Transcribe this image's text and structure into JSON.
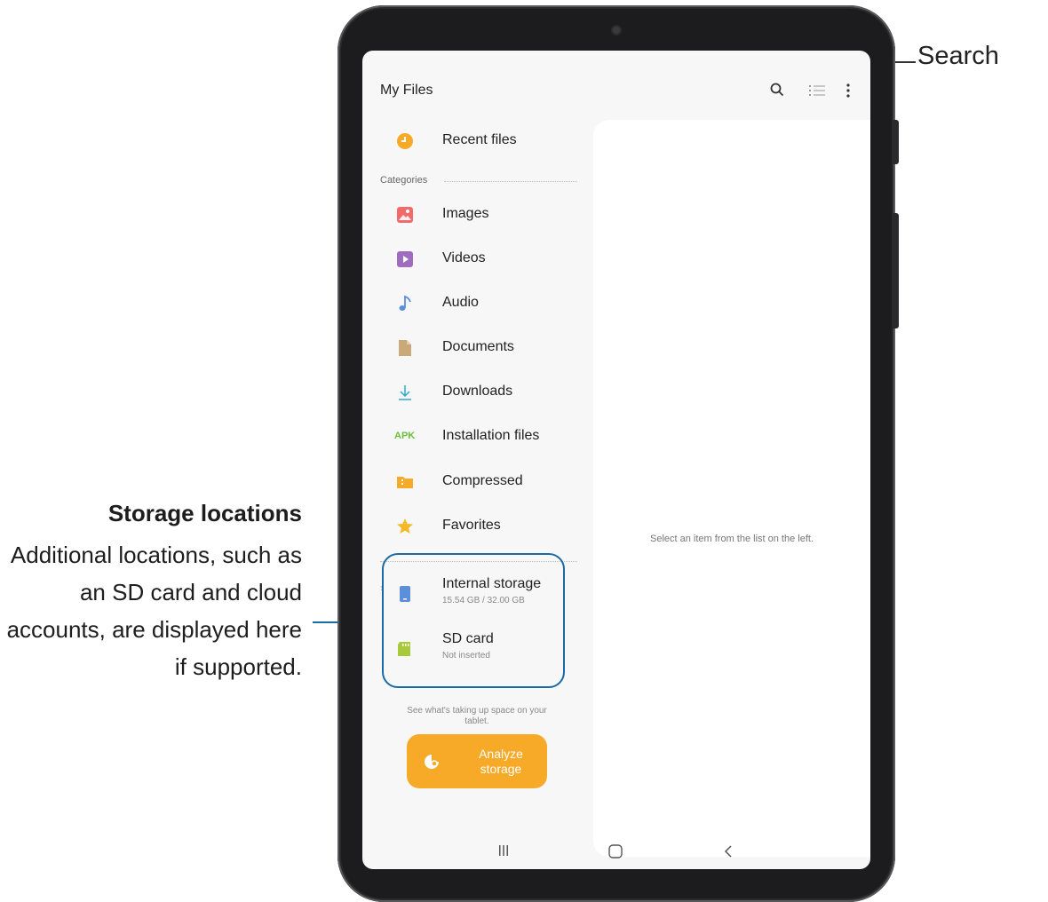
{
  "app": {
    "title": "My Files"
  },
  "toolbar": {
    "search_icon": "search-icon",
    "list_icon": "list-view-icon",
    "more_icon": "more-options-icon"
  },
  "nav": {
    "recent": {
      "label": "Recent files",
      "color": "#f7a928"
    },
    "categories_header": "Categories",
    "categories": [
      {
        "label": "Images",
        "icon": "image-icon",
        "color": "#f26b6b"
      },
      {
        "label": "Videos",
        "icon": "video-icon",
        "color": "#a06cc0"
      },
      {
        "label": "Audio",
        "icon": "music-note-icon",
        "color": "#5b8fd9"
      },
      {
        "label": "Documents",
        "icon": "document-icon",
        "color": "#c9a87a"
      },
      {
        "label": "Downloads",
        "icon": "download-icon",
        "color": "#2fa8c9"
      },
      {
        "label": "Installation files",
        "icon": "apk-icon",
        "color": "#6cbf3a",
        "icon_text": "APK"
      },
      {
        "label": "Compressed",
        "icon": "folder-zip-icon",
        "color": "#f7a928"
      },
      {
        "label": "Favorites",
        "icon": "star-icon",
        "color": "#f7b928"
      }
    ],
    "storage": [
      {
        "label": "Internal storage",
        "sub": "15.54 GB / 32.00 GB",
        "icon": "phone-storage-icon",
        "color": "#5b8fd9"
      },
      {
        "label": "SD card",
        "sub": "Not inserted",
        "icon": "sd-card-icon",
        "color": "#a8c93a"
      }
    ]
  },
  "analyze": {
    "prompt": "See what's taking up space on your tablet.",
    "button": "Analyze\nstorage"
  },
  "main": {
    "empty_message": "Select an item from the list on the left."
  },
  "annotations": {
    "search": "Search",
    "storage_title": "Storage locations",
    "storage_body": "Additional locations, such as an SD card and cloud accounts, are displayed here if supported."
  },
  "colors": {
    "callout": "#1a6aa8",
    "accent": "#f7a928"
  }
}
